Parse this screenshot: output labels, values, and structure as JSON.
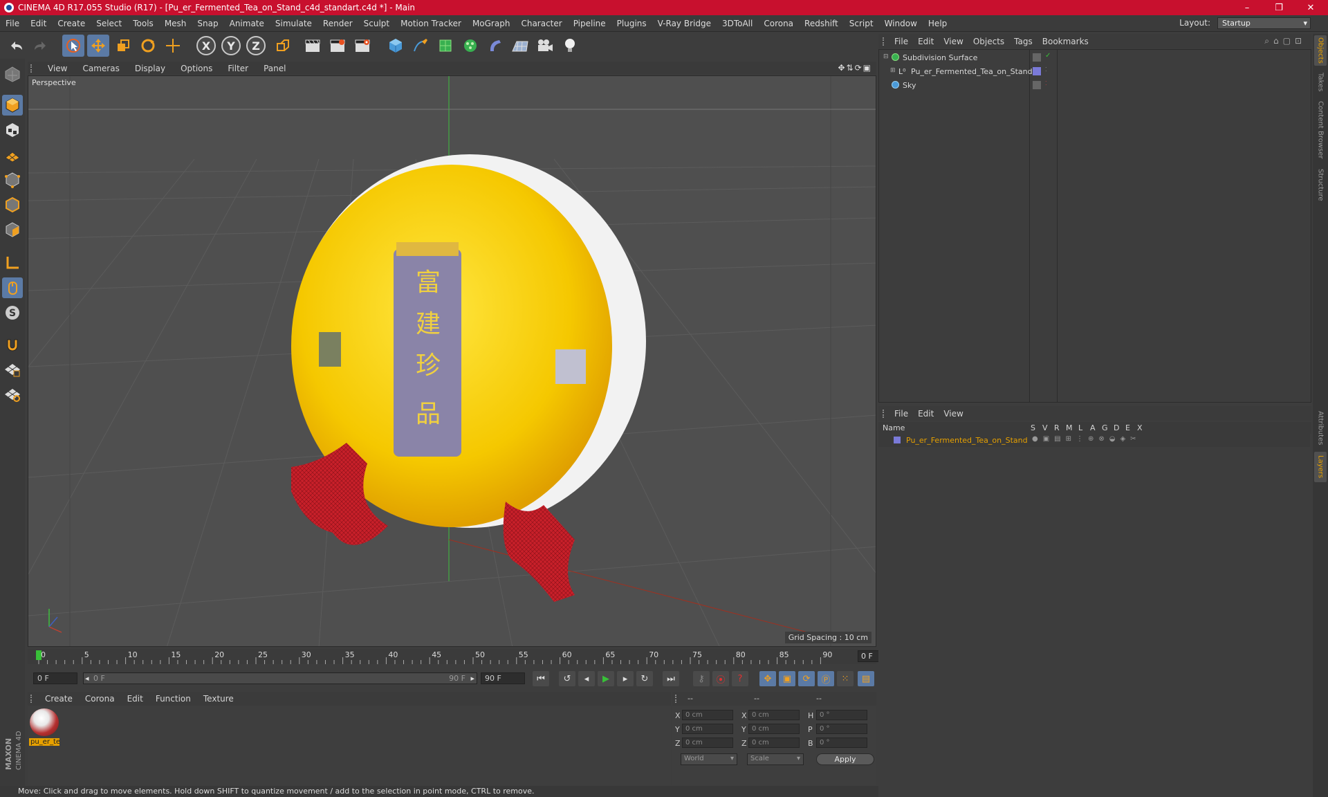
{
  "window": {
    "title": "CINEMA 4D R17.055 Studio (R17) - [Pu_er_Fermented_Tea_on_Stand_c4d_standart.c4d *] - Main",
    "controls": [
      "–",
      "❐",
      "✕"
    ]
  },
  "menubar": {
    "items": [
      "File",
      "Edit",
      "Create",
      "Select",
      "Tools",
      "Mesh",
      "Snap",
      "Animate",
      "Simulate",
      "Render",
      "Sculpt",
      "Motion Tracker",
      "MoGraph",
      "Character",
      "Pipeline",
      "Plugins",
      "V-Ray Bridge",
      "3DToAll",
      "Corona",
      "Redshift",
      "Script",
      "Window",
      "Help"
    ],
    "layout_label": "Layout:",
    "layout_value": "Startup"
  },
  "toolbar": {
    "axes": [
      "X",
      "Y",
      "Z"
    ]
  },
  "viewport": {
    "menu": [
      "View",
      "Cameras",
      "Display",
      "Options",
      "Filter",
      "Panel"
    ],
    "camera_label": "Perspective",
    "grid_spacing": "Grid Spacing : 10 cm",
    "stand_color": "#c8202a",
    "cake_color": "#f5c800"
  },
  "timeline": {
    "ticks": [
      "0",
      "5",
      "10",
      "15",
      "20",
      "25",
      "30",
      "35",
      "40",
      "45",
      "50",
      "55",
      "60",
      "65",
      "70",
      "75",
      "80",
      "85",
      "90"
    ],
    "current_frame": "0 F"
  },
  "transport": {
    "start_field": "0 F",
    "range_start": "0 F",
    "range_end": "90 F",
    "end_field": "90 F"
  },
  "materials": {
    "menu": [
      "Create",
      "Corona",
      "Edit",
      "Function",
      "Texture"
    ],
    "items": [
      {
        "label": "pu_er_te"
      }
    ]
  },
  "coordinates": {
    "header": [
      "--",
      "--",
      "--"
    ],
    "rows": [
      {
        "a": "X",
        "v1": "0 cm",
        "b": "X",
        "v2": "0 cm",
        "c": "H",
        "v3": "0 °"
      },
      {
        "a": "Y",
        "v1": "0 cm",
        "b": "Y",
        "v2": "0 cm",
        "c": "P",
        "v3": "0 °"
      },
      {
        "a": "Z",
        "v1": "0 cm",
        "b": "Z",
        "v2": "0 cm",
        "c": "B",
        "v3": "0 °"
      }
    ],
    "world": "World",
    "scale": "Scale",
    "apply": "Apply"
  },
  "status": "Move: Click and drag to move elements. Hold down SHIFT to quantize movement / add to the selection in point mode, CTRL to remove.",
  "objects": {
    "menu": [
      "File",
      "Edit",
      "View",
      "Objects",
      "Tags",
      "Bookmarks"
    ],
    "rows": [
      {
        "name": "Subdivision Surface"
      },
      {
        "name": "Pu_er_Fermented_Tea_on_Stand"
      },
      {
        "name": "Sky"
      }
    ]
  },
  "layers": {
    "menu": [
      "File",
      "Edit",
      "View"
    ],
    "header_name": "Name",
    "header_cols": [
      "S",
      "V",
      "R",
      "M",
      "L",
      "A",
      "G",
      "D",
      "E",
      "X"
    ],
    "rows": [
      {
        "name": "Pu_er_Fermented_Tea_on_Stand"
      }
    ]
  },
  "right_tabs": [
    "Objects",
    "Takes",
    "Content Browser",
    "Structure",
    "Attributes",
    "Layers"
  ],
  "brand": "MAXON CINEMA 4D"
}
